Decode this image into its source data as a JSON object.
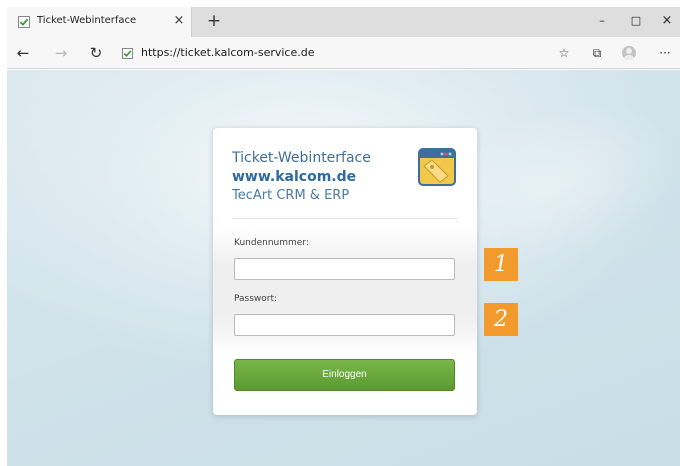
{
  "browser": {
    "tab_title": "Ticket-Webinterface",
    "tab_close": "×",
    "new_tab": "+",
    "window": {
      "minimize": "–",
      "maximize": "□",
      "close": "×"
    },
    "url": "https://ticket.kalcom-service.de",
    "nav": {
      "back": "←",
      "forward": "→",
      "refresh": "↻"
    },
    "toolbar": {
      "favorites": "☆",
      "collections": "⧉",
      "more": "···"
    }
  },
  "login": {
    "title": "Ticket-Webinterface",
    "domain": "www.kalcom.de",
    "subtitle": "TecArt CRM & ERP",
    "customer_number_label": "Kundennummer:",
    "customer_number_value": "",
    "password_label": "Passwort:",
    "password_value": "",
    "submit_label": "Einloggen"
  },
  "markers": [
    "1",
    "2"
  ],
  "colors": {
    "accent_blue": "#2d6aa0",
    "button_green": "#6aa83c",
    "marker_orange": "#f29a2b"
  }
}
